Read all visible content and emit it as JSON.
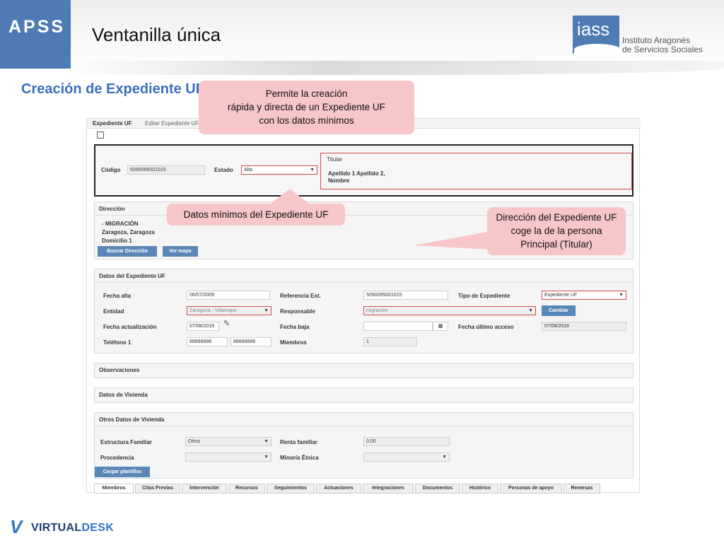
{
  "slide": {
    "brand": "APSS",
    "title": "Ventanilla única",
    "org_abbr": "iass",
    "org_line1": "Instituto Aragonés",
    "org_line2": "de Servicios Sociales",
    "section_title": "Creación de Expediente UF",
    "footer_brand_virtual": "VIRTUAL",
    "footer_brand_desk": "DESK"
  },
  "callouts": {
    "creation_l1": "Permite la creación",
    "creation_l2": "rápida y directa de un Expediente UF",
    "creation_l3": "con los datos mínimos",
    "minimum": "Datos mínimos del Expediente UF",
    "address_l1": "Dirección del Expediente UF",
    "address_l2": "coge la de la persona",
    "address_l3": "Principal (Titular)"
  },
  "app": {
    "tabs": [
      "Expediente UF",
      "Editar Expediente UF"
    ],
    "header": {
      "codigo_label": "Código",
      "codigo_value": "5090095001015",
      "estado_label": "Estado",
      "estado_value": "Alta",
      "titular_label": "Titular",
      "titular_value_l1": "Apellido 1 Apellido 2,",
      "titular_value_l2": "Nombre"
    },
    "direccion": {
      "title": "Dirección",
      "line1": "- MIGRACIÓN",
      "line2": "Zaragoza, Zaragoza",
      "line3": "Domicilio 1",
      "buscar_btn": "Buscar Dirección",
      "mapa_btn": "Ver mapa"
    },
    "datos": {
      "title": "Datos del Expediente UF",
      "fecha_alta_label": "Fecha alta",
      "fecha_alta_value": "06/07/2009",
      "referencia_label": "Referencia Ext.",
      "referencia_value": "5090095001015",
      "tipo_label": "Tipo de Expediente",
      "tipo_value": "Expediente UF",
      "entidad_label": "Entidad",
      "entidad_value": "Zaragoza - Villamapa",
      "responsable_label": "Responsable",
      "responsable_value": "migración",
      "cambiar_btn": "Cambiar",
      "fecha_act_label": "Fecha actualización",
      "fecha_act_value": "07/08/2018",
      "fecha_baja_label": "Fecha baja",
      "fecha_baja_value": "",
      "fecha_acceso_label": "Fecha último acceso",
      "fecha_acceso_value": "07/08/2018",
      "telefono_label": "Teléfono 1",
      "telefono_value1": "88888888",
      "telefono_value2": "88888888",
      "miembros_label": "Miembros",
      "miembros_value": "1"
    },
    "observaciones_title": "Observaciones",
    "vivienda_title": "Datos de Vivienda",
    "otros": {
      "title": "Otros Datos de Vivienda",
      "estructura_label": "Estructura Familiar",
      "estructura_value": "Otros",
      "renta_label": "Renta familiar",
      "renta_value": "0.00",
      "procedencia_label": "Procedencia",
      "procedencia_value": "",
      "minoria_label": "Minoría Étnica",
      "minoria_value": "",
      "cargar_btn": "Cargar plantillas"
    },
    "bottom_tabs": [
      "Miembros",
      "Citas Previas",
      "Intervención",
      "Recursos",
      "Seguimientos",
      "Actuaciones",
      "Integraciones",
      "Documentos",
      "Histórico",
      "Personas de apoyo",
      "Remesas"
    ]
  },
  "colors": {
    "accent": "#4f7bb5",
    "section": "#3a6fc0",
    "callout": "#f6c6c8",
    "error_border": "#d44a4a"
  }
}
